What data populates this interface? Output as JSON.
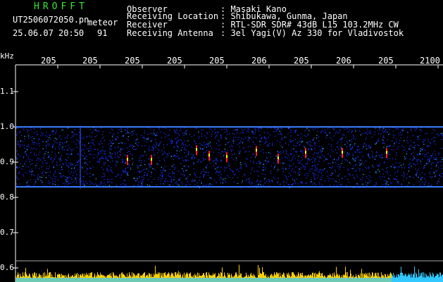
{
  "header": {
    "brand": "HROFFT",
    "filename": "UT2506072050.pn",
    "mode": "meteor",
    "datetime": "25.06.07 20:50",
    "count": "91",
    "fields": [
      {
        "label": "Observer",
        "value": ": Masaki Kano"
      },
      {
        "label": "Receiving Location",
        "value": ": Shibukawa, Gunma, Japan"
      },
      {
        "label": "Receiver",
        "value": ": RTL-SDR SDR# 43dB L15 103.2MHz CW"
      },
      {
        "label": "Receiving Antenna",
        "value": ": 3el Yagi(V) Az 330 for Vladivostok"
      }
    ]
  },
  "spectrogram": {
    "y_unit": "kHz",
    "y_ticks": [
      "1.1",
      "1.0",
      "0.9",
      "0.8",
      "0.7",
      "0.6"
    ],
    "x_ticks": [
      "205",
      "205",
      "205",
      "205",
      "205",
      "206",
      "205",
      "206",
      "205",
      "2100"
    ],
    "colors": {
      "background": "#000000",
      "noise": "#1a2fff",
      "signal": "#ff2020",
      "peak": "#ffff00",
      "bars": "#ffd000",
      "bar_base": "#30c8ff"
    }
  }
}
